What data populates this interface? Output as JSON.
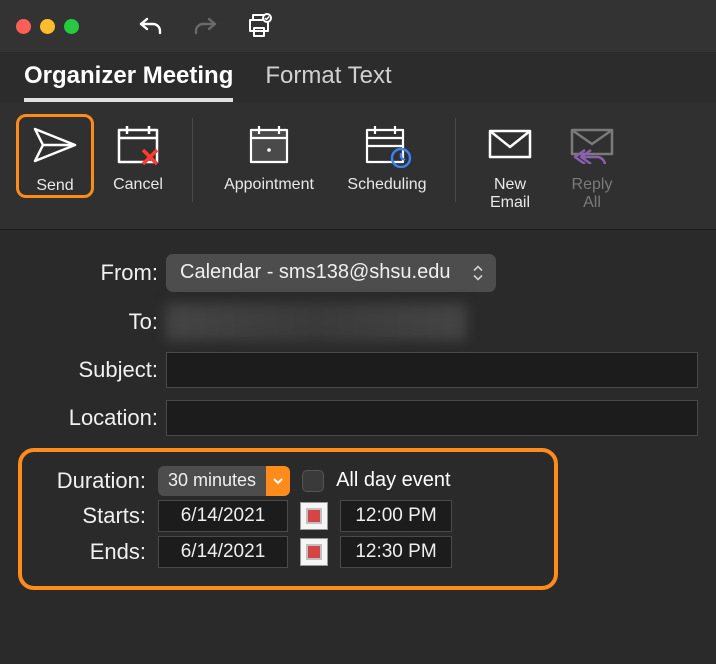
{
  "titlebar": {},
  "tabs": {
    "active": "Organizer Meeting",
    "other": "Format Text"
  },
  "ribbon": {
    "send": "Send",
    "cancel": "Cancel",
    "appointment": "Appointment",
    "scheduling": "Scheduling",
    "new_email_l1": "New",
    "new_email_l2": "Email",
    "reply_all_l1": "Reply",
    "reply_all_l2": "All"
  },
  "form": {
    "from_label": "From:",
    "from_value": "Calendar - sms138@shsu.edu",
    "to_label": "To:",
    "to_value": "",
    "subject_label": "Subject:",
    "subject_value": "",
    "location_label": "Location:",
    "location_value": ""
  },
  "duration": {
    "label": "Duration:",
    "value": "30 minutes",
    "all_day_label": "All day event",
    "starts_label": "Starts:",
    "ends_label": "Ends:",
    "start_date": "6/14/2021",
    "start_time": "12:00 PM",
    "end_date": "6/14/2021",
    "end_time": "12:30 PM"
  }
}
